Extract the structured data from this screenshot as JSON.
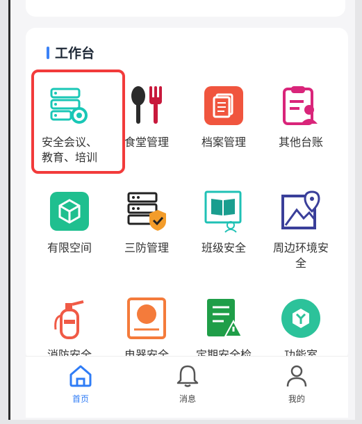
{
  "section": {
    "title": "工作台"
  },
  "tiles": [
    {
      "label": "安全会议、\n教育、培训"
    },
    {
      "label": "食堂管理"
    },
    {
      "label": "档案管理"
    },
    {
      "label": "其他台账"
    },
    {
      "label": "有限空间"
    },
    {
      "label": "三防管理"
    },
    {
      "label": "班级安全"
    },
    {
      "label": "周边环境安\n全"
    },
    {
      "label": "消防安全"
    },
    {
      "label": "电器安全"
    },
    {
      "label": "定期安全检"
    },
    {
      "label": "功能室"
    }
  ],
  "tabs": [
    {
      "label": "首页",
      "active": true
    },
    {
      "label": "消息",
      "active": false
    },
    {
      "label": "我的",
      "active": false
    }
  ],
  "colors": {
    "accent": "#2f7cf6",
    "highlight": "#f23b3b"
  }
}
